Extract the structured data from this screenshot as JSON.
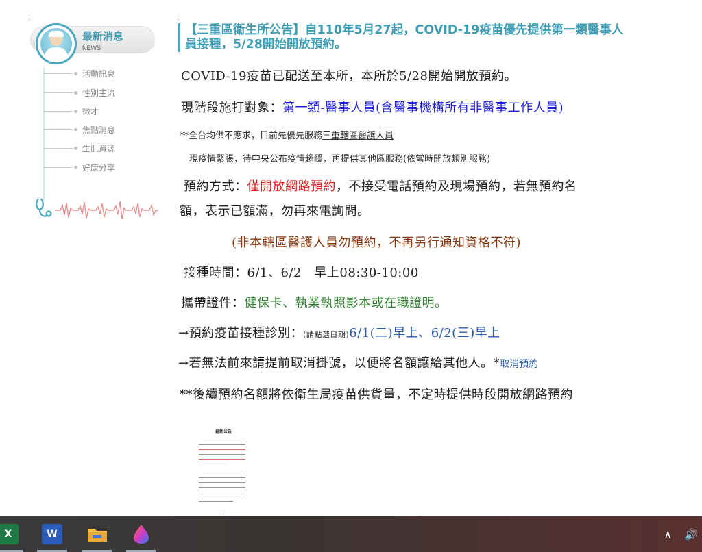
{
  "sidebar": {
    "news_title": "最新消息",
    "news_sub": "NEWS",
    "items": [
      {
        "label": "活動訊息"
      },
      {
        "label": "性別主流"
      },
      {
        "label": "徵才"
      },
      {
        "label": "焦點消息"
      },
      {
        "label": "生肌資源"
      },
      {
        "label": "好康分享"
      }
    ]
  },
  "article": {
    "title": "【三重區衛生所公告】自110年5月27起，COVID-19疫苗優先提供第一類醫事人員接種，5/28開始開放預約。",
    "line1": "COVID-19疫苗已配送至本所，本所於5/28開始開放預約。",
    "line2_prefix": "現階段施打對象：",
    "line2_highlight": "第一類-醫事人員(含醫事機構所有非醫事工作人員)",
    "line3_prefix": "**全台均供不應求，目前先優先服務",
    "line3_underline": "三重轄區醫護人員",
    "line4": "現疫情緊張，待中央公布疫情趨緩，再提供其他區服務(依當時開放類別服務)",
    "line5_prefix": "預約方式：",
    "line5_red": "僅開放網路預約",
    "line5_suffix": "，不接受電話預約及現場預約，若無預約名",
    "line6": "額，表示已額滿，勿再來電詢問。",
    "line7": "(非本轄區醫護人員勿預約，不再另行通知資格不符)",
    "line8": "接種時間：6/1、6/2　早上08:30-10:00",
    "line9_prefix": "攜帶證件：",
    "line9_green": "健保卡、執業執照影本或在職證明。",
    "line10_prefix": "→預約疫苗接種診別：",
    "line10_small": "(請點選日期)",
    "line10_link": "6/1(二)早上、6/2(三)早上",
    "line11_prefix": "→若無法前來請提前取消掛號，以便將名額讓給其他人。*",
    "line11_link": "取消預約",
    "line12": "**後續預約名額將依衛生局疫苗供貨量，不定時提供時段開放網路預約",
    "doc_title": "最新公告"
  },
  "taskbar": {
    "apps": [
      {
        "name": "excel",
        "letter": "X",
        "color": "#1f7a45"
      },
      {
        "name": "word",
        "letter": "W",
        "color": "#2b5cb8"
      },
      {
        "name": "file-explorer",
        "letter": "",
        "color": "#f2c14e"
      },
      {
        "name": "paint",
        "letter": "",
        "color": "#d946b5"
      }
    ],
    "tray_chevron": "∧",
    "tray_speaker": "🔊"
  },
  "colors": {
    "accent": "#46a7bd",
    "title": "#3f9db4",
    "blue_text": "#2222dd",
    "red_text": "#e02020",
    "brown_text": "#8a3a10",
    "green_text": "#2f7f2f"
  }
}
